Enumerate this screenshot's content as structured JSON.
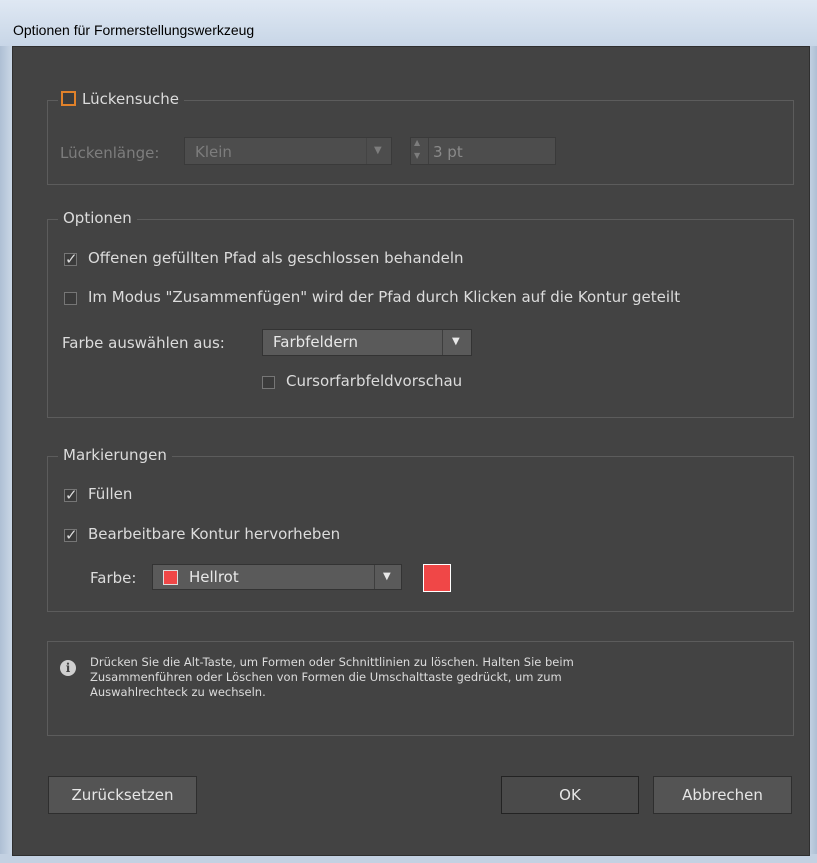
{
  "window": {
    "title": "Optionen für Formerstellungswerkzeug"
  },
  "gap": {
    "checkbox_label": "Lückensuche",
    "length_label": "Lückenlänge:",
    "length_value": "Klein",
    "size_value": "3 pt"
  },
  "options": {
    "legend": "Optionen",
    "open_path_label": "Offenen gefüllten Pfad als geschlossen behandeln",
    "merge_mode_label": "Im Modus \"Zusammenfügen\" wird der Pfad durch Klicken auf die Kontur geteilt",
    "color_label": "Farbe auswählen aus:",
    "color_source_value": "Farbfeldern",
    "cursor_preview_label": "Cursorfarbfeldvorschau"
  },
  "highlight": {
    "legend": "Markierungen",
    "fill_label": "Füllen",
    "editable_stroke_label": "Bearbeitbare Kontur hervorheben",
    "color_label": "Farbe:",
    "color_value": "Hellrot",
    "swatch_color": "#f04747"
  },
  "info": {
    "line1": "Drücken Sie die Alt-Taste, um Formen oder Schnittlinien zu löschen. Halten Sie beim",
    "line2": "Zusammenführen oder Löschen von Formen die Umschalttaste gedrückt, um zum",
    "line3": "Auswahlrechteck zu wechseln."
  },
  "buttons": {
    "reset": "Zurücksetzen",
    "ok": "OK",
    "cancel": "Abbrechen"
  }
}
